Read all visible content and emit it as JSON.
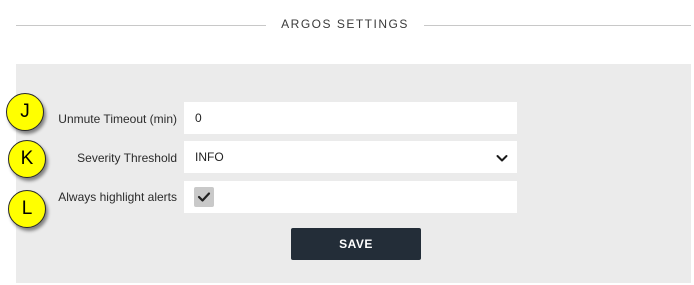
{
  "header": {
    "title": "ARGOS SETTINGS"
  },
  "settings": {
    "unmute_timeout": {
      "label": "Unmute Timeout (min)",
      "value": "0"
    },
    "severity_threshold": {
      "label": "Severity Threshold",
      "value": "INFO"
    },
    "always_highlight": {
      "label": "Always highlight alerts",
      "checked": true
    },
    "save_label": "SAVE"
  },
  "callouts": [
    "J",
    "K",
    "L"
  ],
  "colors": {
    "panel_background": "#ebebeb",
    "button_background": "#232d38",
    "callout_fill": "#ffff00",
    "checkbox_fill": "#c9c9c9"
  },
  "icons": {
    "select_chevron": "chevron-down-icon",
    "checkbox_mark": "checkmark-icon"
  }
}
